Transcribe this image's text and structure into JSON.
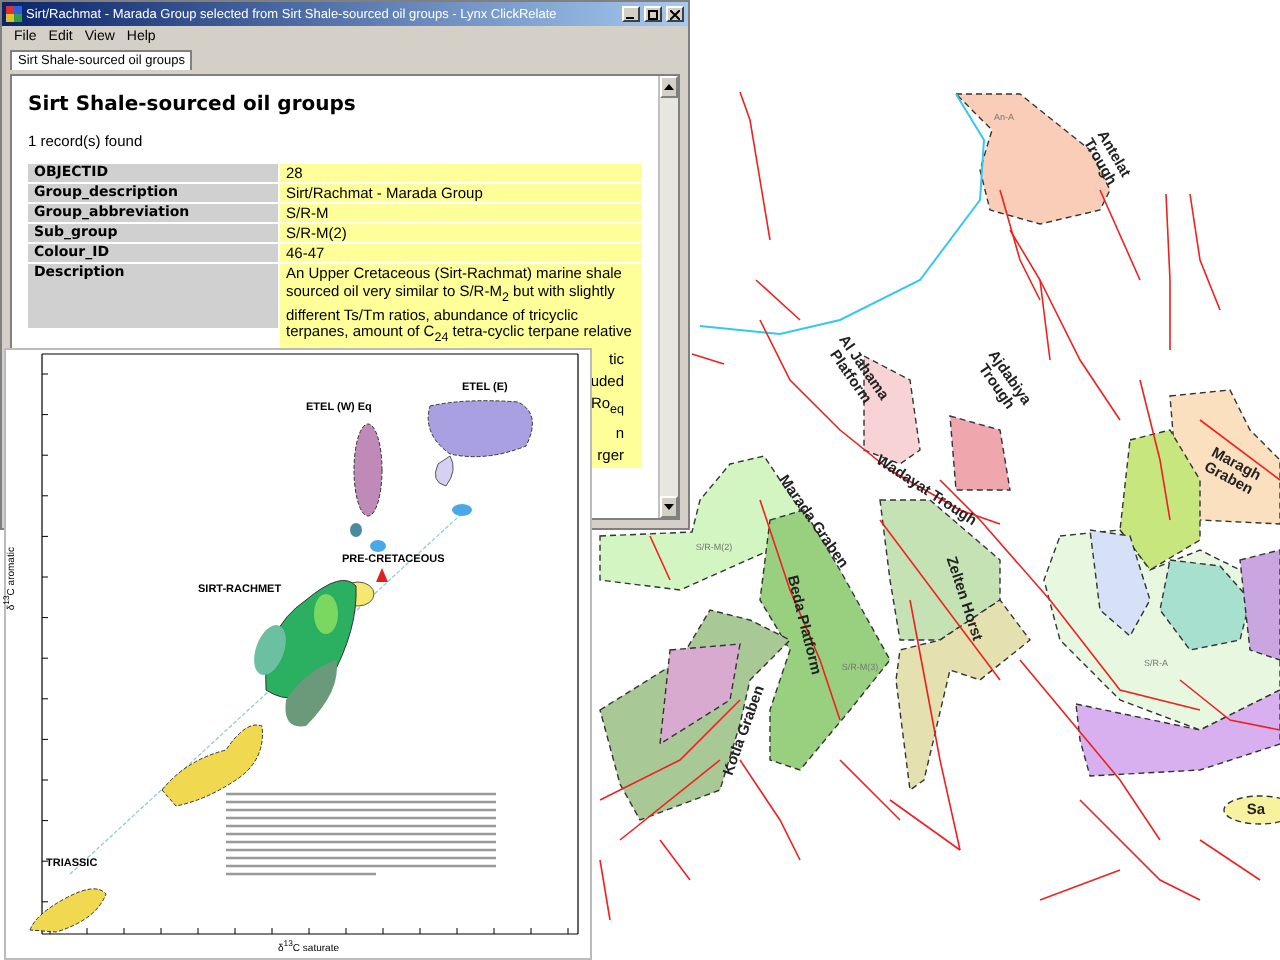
{
  "window": {
    "title": "Sirt/Rachmat - Marada Group selected from Sirt Shale-sourced oil groups - Lynx ClickRelate",
    "menu": [
      "File",
      "Edit",
      "View",
      "Help"
    ],
    "tabs": [
      {
        "label": "Sirt Shale-sourced oil groups",
        "selected": true
      }
    ],
    "heading": "Sirt Shale-sourced oil groups",
    "record_count": "1 record(s) found",
    "record": [
      {
        "field": "OBJECTID",
        "value": "28"
      },
      {
        "field": "Group_description",
        "value": "Sirt/Rachmat - Marada Group"
      },
      {
        "field": "Group_abbreviation",
        "value": "S/R-M"
      },
      {
        "field": "Sub_group",
        "value": "S/R-M(2)"
      },
      {
        "field": "Colour_ID",
        "value": "46-47"
      }
    ],
    "description": {
      "field": "Description",
      "lines": [
        "An Upper Cretaceous (Sirt-Rachmat) marine shale",
        "sourced oil very similar to S/R-M$_{2}$  but with slightly",
        "different Ts/Tm ratios, abundance of tricyclic",
        "terpanes, amount of C$_{24}$ tetra-cyclic terpane relative"
      ],
      "fragments": [
        "tic",
        "uded",
        "Ro$_{eq}$",
        "n",
        "rger"
      ]
    }
  },
  "figure": {
    "ylabel": "δ$^{13}$C aromatic",
    "xlabel": "δ$^{13}$C saturate",
    "labels": [
      "ETEL (E)",
      "ETEL (W) Eq",
      "PRE-CRETACEOUS",
      "SIRT-RACHMET",
      "TRIASSIC"
    ]
  },
  "map": {
    "labels": [
      {
        "kind": "region",
        "lines": [
          "Antelat",
          "Trough"
        ]
      },
      {
        "kind": "region",
        "lines": [
          "Al Jahama",
          "Platform"
        ]
      },
      {
        "kind": "region",
        "lines": [
          "Ajdabiya",
          "Trough"
        ]
      },
      {
        "kind": "region",
        "lines": [
          "Marada Graben"
        ]
      },
      {
        "kind": "region",
        "lines": [
          "Wadayat Trough"
        ]
      },
      {
        "kind": "region",
        "lines": [
          "Zelten Horst"
        ]
      },
      {
        "kind": "region",
        "lines": [
          "Beda Platform"
        ]
      },
      {
        "kind": "region",
        "lines": [
          "Kotla Graben"
        ]
      },
      {
        "kind": "region",
        "lines": [
          "Maragh",
          "Graben"
        ]
      },
      {
        "kind": "region",
        "lines": [
          "Sa"
        ]
      },
      {
        "kind": "unit",
        "lines": [
          "An-A"
        ]
      },
      {
        "kind": "unit",
        "lines": [
          "S/R-A"
        ]
      },
      {
        "kind": "unit",
        "lines": [
          "S/R-M(3)"
        ]
      },
      {
        "kind": "unit",
        "lines": [
          "S/R-M(2)"
        ]
      }
    ]
  }
}
